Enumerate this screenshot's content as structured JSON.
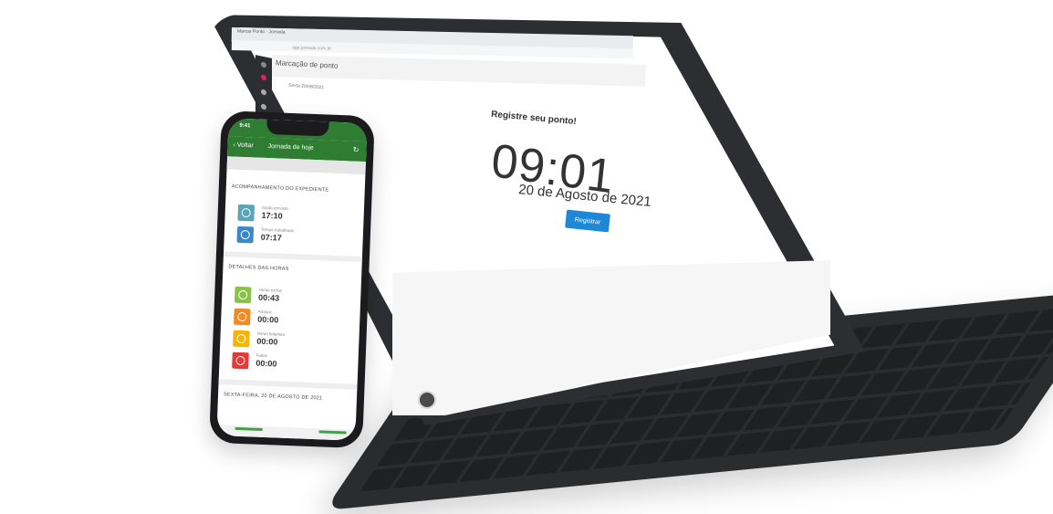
{
  "tablet": {
    "browser_tab_title": "Marcar Ponto · Jornada",
    "url_text": "app.jornada.com.br",
    "page_title": "Marcação de ponto",
    "page_subtitle": "Sexta 20/08/2021",
    "register": {
      "heading": "Registre seu ponto!",
      "time": "09:01",
      "date": "20 de Agosto de 2021",
      "button_label": "Registrar"
    },
    "sidebar_icons": [
      "logo-icon",
      "bell-icon",
      "clock-icon",
      "user-icon"
    ],
    "accent_color": "#1e88d6"
  },
  "phone": {
    "status_time": "9:41",
    "header": {
      "back_label": "Voltar",
      "title": "Jornada de hoje",
      "refresh_icon": "refresh-icon"
    },
    "tracking": {
      "section_title": "ACOMPANHAMENTO DO EXPEDIENTE",
      "items": [
        {
          "label": "Saída prevista",
          "value": "17:10",
          "color": "#5aa3b8",
          "icon": "clock-icon"
        },
        {
          "label": "Tempo trabalhado",
          "value": "07:17",
          "color": "#3b88c9",
          "icon": "clock-icon"
        }
      ]
    },
    "details": {
      "section_title": "DETALHES DAS HORAS",
      "items": [
        {
          "label": "Horas extras",
          "value": "00:43",
          "color": "#8bc34a",
          "icon": "clock-icon"
        },
        {
          "label": "Atrasos",
          "value": "00:00",
          "color": "#f08a24",
          "icon": "clock-icon"
        },
        {
          "label": "Horas faltantes",
          "value": "00:00",
          "color": "#f4b400",
          "icon": "clock-icon"
        },
        {
          "label": "Faltas",
          "value": "00:00",
          "color": "#e53935",
          "icon": "clock-icon"
        }
      ]
    },
    "day_section_title": "SEXTA-FEIRA, 20 DE AGOSTO DE 2021",
    "brand_color": "#2e7d32"
  }
}
